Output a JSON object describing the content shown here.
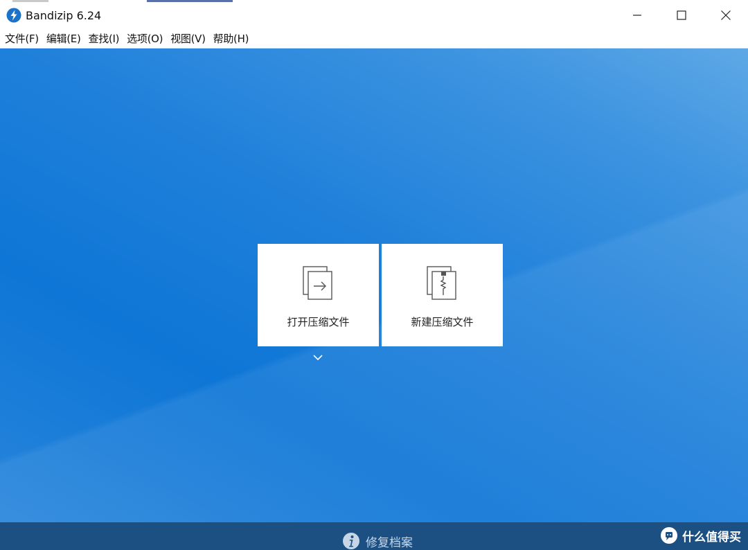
{
  "window": {
    "title": "Bandizip 6.24",
    "icon": "bandizip-logo-icon",
    "controls": [
      "minimize-icon",
      "maximize-icon",
      "close-icon"
    ]
  },
  "menu": {
    "items": [
      {
        "label": "文件(F)"
      },
      {
        "label": "编辑(E)"
      },
      {
        "label": "查找(I)"
      },
      {
        "label": "选项(O)"
      },
      {
        "label": "视图(V)"
      },
      {
        "label": "帮助(H)"
      }
    ]
  },
  "actions": {
    "open_archive": {
      "label": "打开压缩文件",
      "icon": "open-archive-icon"
    },
    "new_archive": {
      "label": "新建压缩文件",
      "icon": "zip-archive-icon"
    },
    "more_icon": "chevron-down-icon"
  },
  "footer": {
    "repair_label": "修复档案",
    "repair_icon": "info-icon"
  },
  "watermark": {
    "text": "什么值得买",
    "icon": "smzdm-logo-icon"
  },
  "colors": {
    "workspace_blue": "#1f80da",
    "footer_bar": "#1c4f82",
    "tile_bg": "#ffffff",
    "app_icon_blue": "#1a73c9"
  }
}
